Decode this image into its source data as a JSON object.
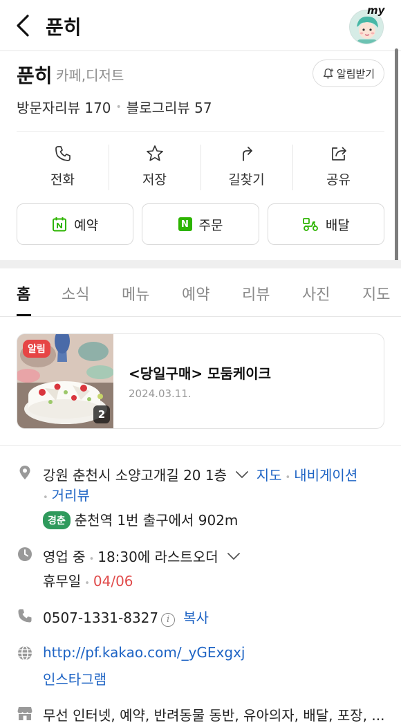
{
  "header": {
    "title": "푼히",
    "avatar_badge": "my"
  },
  "place": {
    "name": "푼히",
    "category": "카페,디저트",
    "alarm_label": "알림받기",
    "visitor_reviews": "방문자리뷰 170",
    "blog_reviews": "블로그리뷰 57"
  },
  "actions": [
    {
      "label": "전화",
      "icon": "phone-icon"
    },
    {
      "label": "저장",
      "icon": "star-icon"
    },
    {
      "label": "길찾기",
      "icon": "directions-icon"
    },
    {
      "label": "공유",
      "icon": "share-icon"
    }
  ],
  "pills": [
    {
      "label": "예약",
      "icon": "calendar-n-icon"
    },
    {
      "label": "주문",
      "icon": "naver-n-icon",
      "icon_text": "N"
    },
    {
      "label": "배달",
      "icon": "delivery-scooter-icon"
    }
  ],
  "tabs": [
    "홈",
    "소식",
    "메뉴",
    "예약",
    "리뷰",
    "사진",
    "지도"
  ],
  "active_tab": "홈",
  "news": {
    "badge": "알림",
    "title": "<당일구매> 모둠케이크",
    "date": "2024.03.11.",
    "image_count": "2"
  },
  "info": {
    "address": "강원 춘천시 소양고개길 20 1층",
    "map_link": "지도",
    "navigation_link": "내비게이션",
    "street_view_link": "거리뷰",
    "subway_line": "경춘",
    "subway_text": "춘천역 1번 출구에서 902m",
    "hours_status": "영업 중",
    "hours_last_order": "18:30에 라스트오더",
    "holiday_label": "휴무일",
    "holiday_date": "04/06",
    "phone": "0507-1331-8327",
    "copy_label": "복사",
    "website": "http://pf.kakao.com/_yGExgxj",
    "instagram": "인스타그램",
    "amenities": "무선 인터넷, 예약, 반려동물 동반, 유아의자, 배달, 포장, ..."
  },
  "colors": {
    "accent_green": "#2db400",
    "link_blue": "#1d63c4",
    "alert_red": "#e64545",
    "holiday_red": "#e04b4b",
    "line_green": "#2f9a5c"
  }
}
